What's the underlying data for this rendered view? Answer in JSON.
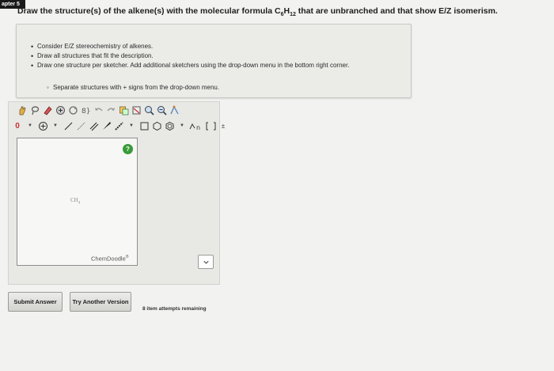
{
  "header": {
    "chapter_label": "apter 5"
  },
  "question": {
    "text_before": "Draw the structure(s) of the alkene(s) with the molecular formula C",
    "sub1": "6",
    "text_mid": "H",
    "sub2": "12",
    "text_after": " that are unbranched and that show E/Z isomerism."
  },
  "instructions": {
    "items": [
      "Consider E/Z stereochemistry of alkenes.",
      "Draw all structures that fit the description.",
      "Draw one structure per sketcher. Add additional sketchers using the drop-down menu in the bottom right corner."
    ],
    "sub_item": "Separate structures with + signs from the drop-down menu."
  },
  "sketcher": {
    "help_label": "?",
    "canvas_text_main": "CH",
    "canvas_text_sub": "4",
    "logo": "ChemDoodle",
    "logo_mark": "®",
    "toolbar_zero": "0",
    "toolbar_n": "n"
  },
  "actions": {
    "submit_label": "Submit Answer",
    "try_label": "Try Another Version",
    "attempts_text": "8 item attempts remaining"
  },
  "colors": {
    "help": "#3a9a3a",
    "background": "#f2f2f0"
  }
}
